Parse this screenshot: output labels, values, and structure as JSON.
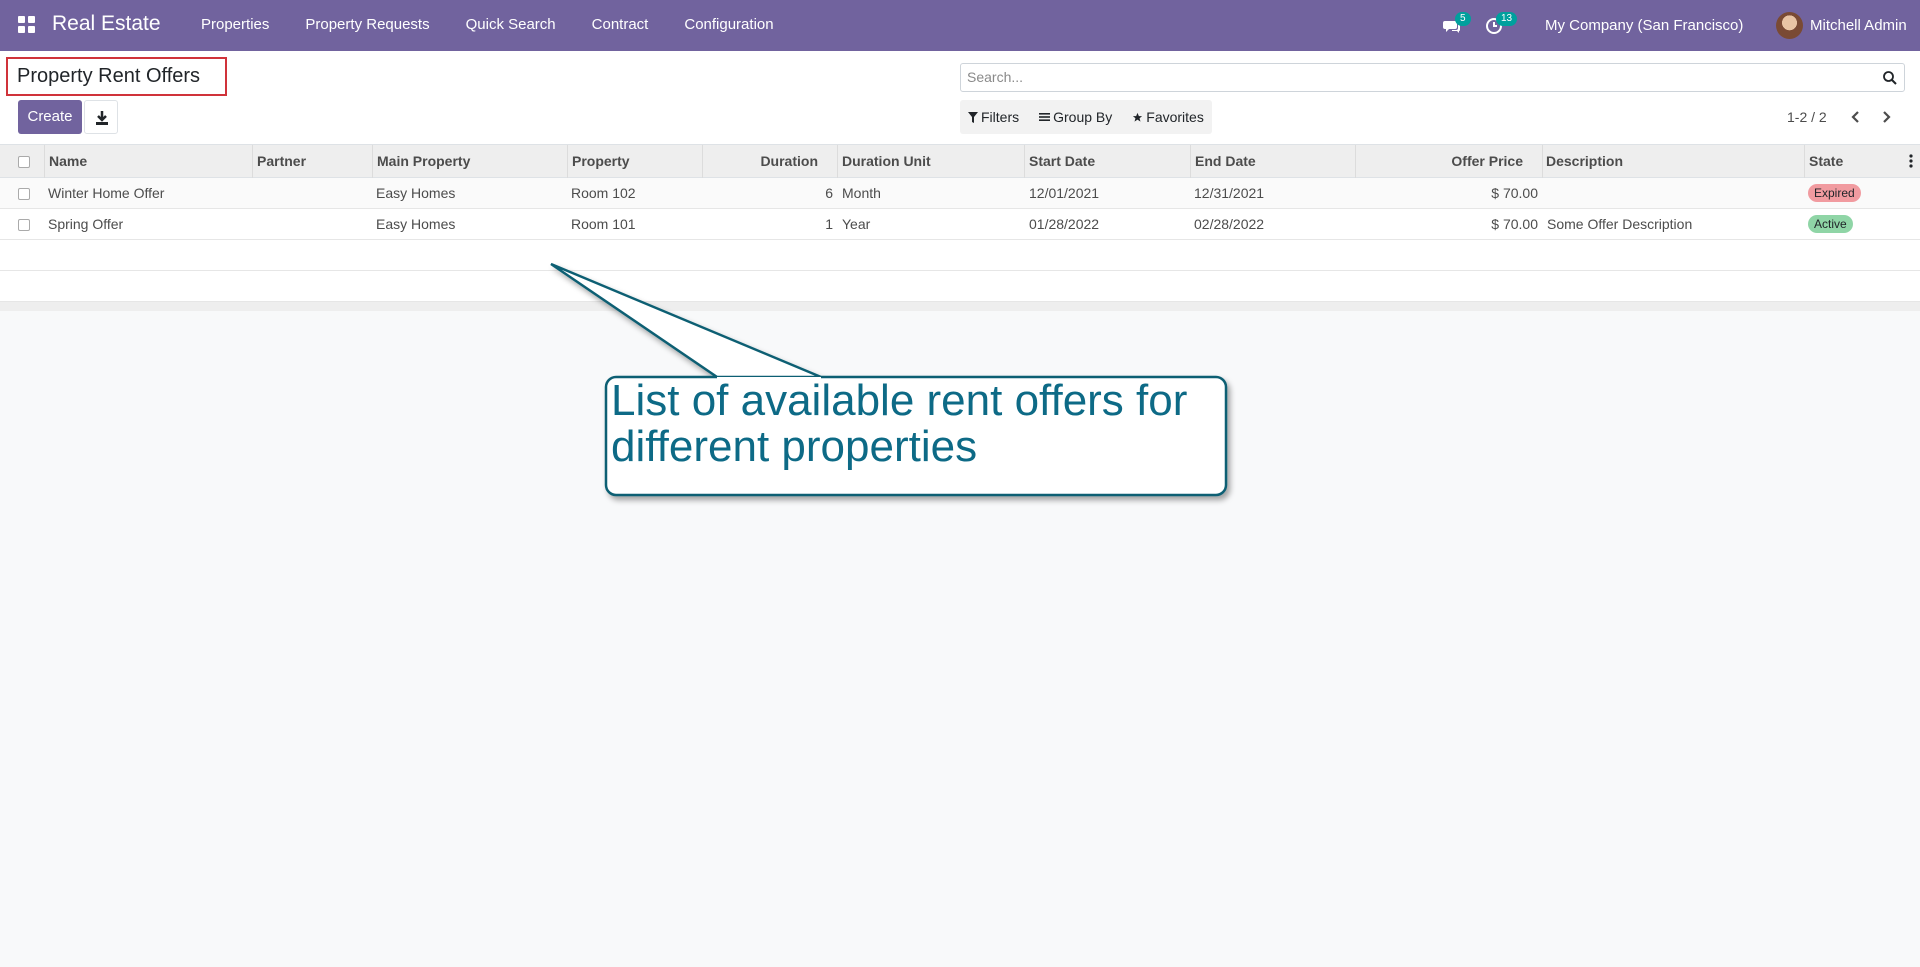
{
  "navbar": {
    "brand": "Real Estate",
    "menu": [
      "Properties",
      "Property Requests",
      "Quick Search",
      "Contract",
      "Configuration"
    ],
    "messages_badge": "5",
    "activities_badge": "13",
    "company": "My Company (San Francisco)",
    "user": "Mitchell Admin",
    "icons": {
      "apps": "apps-grid-icon",
      "messages": "chat-icon",
      "activities": "clock-icon"
    },
    "bg_color": "#71639e"
  },
  "control_panel": {
    "title": "Property Rent Offers",
    "create_label": "Create",
    "search_placeholder": "Search...",
    "filters_label": "Filters",
    "group_by_label": "Group By",
    "favorites_label": "Favorites",
    "pager": "1-2 / 2"
  },
  "table": {
    "columns": [
      "Name",
      "Partner",
      "Main Property",
      "Property",
      "Duration",
      "Duration Unit",
      "Start Date",
      "End Date",
      "Offer Price",
      "Description",
      "State"
    ],
    "rows": [
      {
        "name": "Winter Home Offer",
        "partner": "",
        "main_property": "Easy Homes",
        "property": "Room 102",
        "duration": "6",
        "duration_unit": "Month",
        "start_date": "12/01/2021",
        "end_date": "12/31/2021",
        "offer_price": "$ 70.00",
        "description": "",
        "state": "Expired",
        "state_color": "#f19ba0"
      },
      {
        "name": "Spring Offer",
        "partner": "",
        "main_property": "Easy Homes",
        "property": "Room 101",
        "duration": "1",
        "duration_unit": "Year",
        "start_date": "01/28/2022",
        "end_date": "02/28/2022",
        "offer_price": "$ 70.00",
        "description": "Some Offer Description",
        "state": "Active",
        "state_color": "#8fd5a6"
      }
    ]
  },
  "annotation": {
    "text": "List of available rent offers for different properties",
    "color": "#0d6a86"
  }
}
